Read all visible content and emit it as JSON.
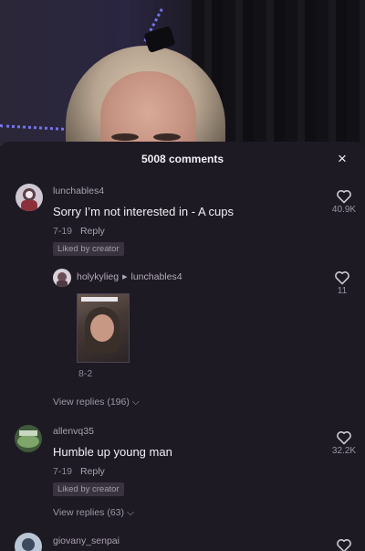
{
  "header": {
    "comment_count_label": "5008 comments",
    "close_icon": "close-icon",
    "close_glyph": "×"
  },
  "comments": [
    {
      "username": "lunchables4",
      "text": "Sorry I’m not interested in - A cups",
      "date": "7-19",
      "reply_label": "Reply",
      "badge": "Liked by creator",
      "likes": "40.9K",
      "view_replies": "View replies (196)"
    },
    {
      "username": "allenvq35",
      "text": "Humble up young man",
      "date": "7-19",
      "reply_label": "Reply",
      "badge": "Liked by creator",
      "likes": "32.2K",
      "view_replies": "View replies (63)"
    },
    {
      "username": "giovany_senpai"
    }
  ],
  "reply": {
    "username": "holykylieg",
    "replying_to": "lunchables4",
    "date": "8-2",
    "likes": "11"
  },
  "colors": {
    "sheet_bg": "#1e1a24",
    "muted_text": "#9d97a6",
    "badge_bg": "#39333f"
  }
}
